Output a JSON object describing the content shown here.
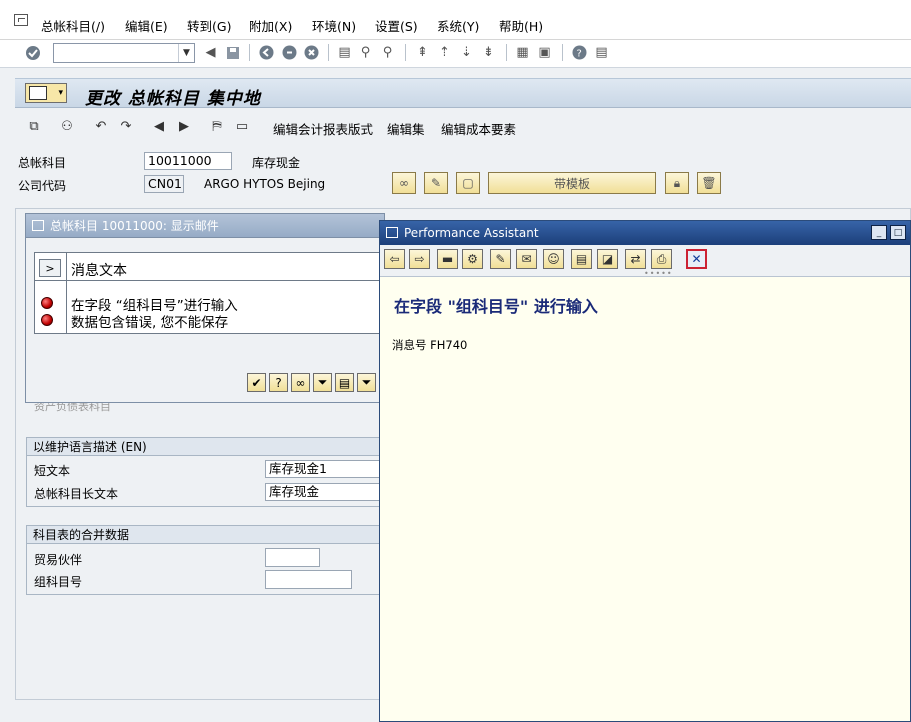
{
  "menu": {
    "items": [
      "总帐科目(/)",
      "编辑(E)",
      "转到(G)",
      "附加(X)",
      "环境(N)",
      "设置(S)",
      "系统(Y)",
      "帮助(H)"
    ]
  },
  "screen": {
    "title": "更改 总帐科目 集中地"
  },
  "app_toolbar": {
    "btn_report_layout": "编辑会计报表版式",
    "btn_edit_set": "编辑集",
    "btn_cost_element": "编辑成本要素"
  },
  "header": {
    "account_label": "总帐科目",
    "account_value": "10011000",
    "account_desc": "库存现金",
    "company_label": "公司代码",
    "company_value": "CN01",
    "company_desc": "ARGO HYTOS Bejing",
    "template_button": "带模板"
  },
  "message_dialog": {
    "title": "总帐科目 10011000: 显示邮件",
    "column_header": "消息文本",
    "messages": [
      "在字段 “组科目号”进行输入",
      "数据包含错误, 您不能保存"
    ]
  },
  "partial_text": {
    "radio_balance_sheet": "资产负债表科目"
  },
  "group_description": {
    "title": "以维护语言描述 (EN)",
    "short_text_label": "短文本",
    "short_text_value": "库存现金1",
    "long_text_label": "总帐科目长文本",
    "long_text_value": "库存现金"
  },
  "group_consolidation": {
    "title": "科目表的合并数据",
    "partner_label": "贸易伙伴",
    "partner_value": "",
    "group_account_label": "组科目号",
    "group_account_value": ""
  },
  "performance_assistant": {
    "title": "Performance Assistant",
    "heading": "在字段 \"组科目号\" 进行输入",
    "message_no": "消息号 FH740"
  },
  "colors": {
    "pa_title_bar": "#1c3f7a",
    "pa_background": "#fffff0",
    "error_light": "#c00000",
    "heading_text": "#1a2a78"
  }
}
